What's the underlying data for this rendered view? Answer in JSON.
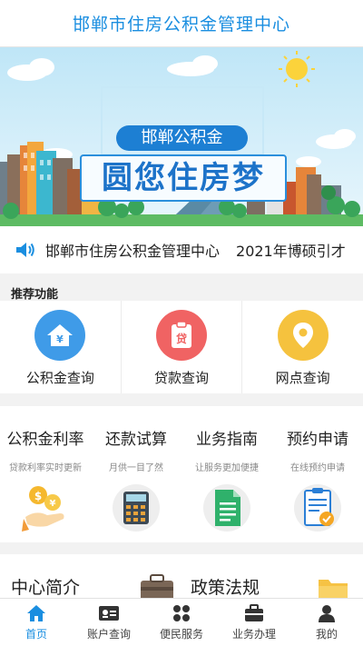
{
  "header": {
    "title": "邯郸市住房公积金管理中心"
  },
  "banner": {
    "subtitle": "邯郸公积金",
    "title": "圆您住房梦"
  },
  "notice": {
    "items": [
      "邯郸市住房公积金管理中心",
      "2021年博硕引才"
    ]
  },
  "recommended": {
    "title": "推荐功能",
    "items": [
      {
        "label": "公积金查询",
        "icon": "house-yen-icon",
        "color": "#3f9be8"
      },
      {
        "label": "贷款查询",
        "icon": "loan-document-icon",
        "color": "#f06363"
      },
      {
        "label": "网点查询",
        "icon": "map-pin-icon",
        "color": "#f5c23e"
      }
    ]
  },
  "services": [
    {
      "title": "公积金利率",
      "desc": "贷款利率实时更新",
      "icon": "coins-hand-icon"
    },
    {
      "title": "还款试算",
      "desc": "月供一目了然",
      "icon": "calculator-icon"
    },
    {
      "title": "业务指南",
      "desc": "让服务更加便捷",
      "icon": "document-icon"
    },
    {
      "title": "预约申请",
      "desc": "在线预约申请",
      "icon": "clipboard-check-icon"
    }
  ],
  "about": {
    "items": [
      "中心简介",
      "政策法规"
    ]
  },
  "tabbar": [
    {
      "label": "首页",
      "icon": "home-icon",
      "active": true
    },
    {
      "label": "账户查询",
      "icon": "id-card-icon",
      "active": false
    },
    {
      "label": "便民服务",
      "icon": "grid-icon",
      "active": false
    },
    {
      "label": "业务办理",
      "icon": "briefcase-icon",
      "active": false
    },
    {
      "label": "我的",
      "icon": "person-icon",
      "active": false
    }
  ],
  "colors": {
    "accent": "#1a8ee0"
  }
}
